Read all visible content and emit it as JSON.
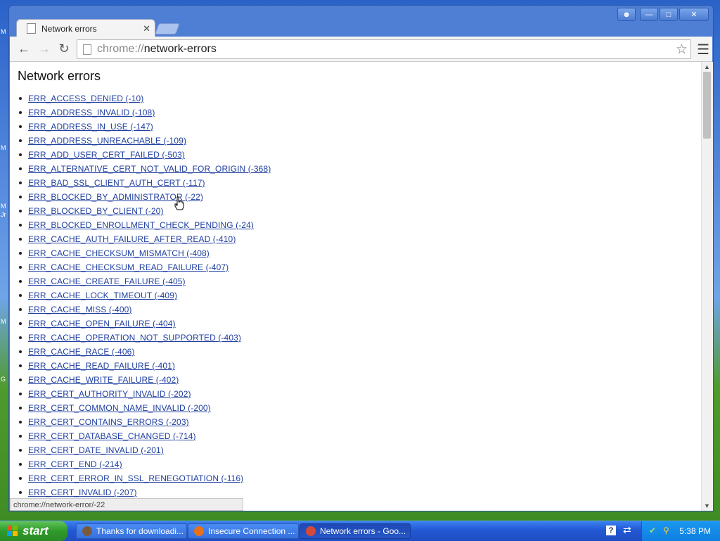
{
  "desktop": {
    "side_labels": [
      "M",
      "M",
      "M",
      "Jr",
      "M",
      "G"
    ]
  },
  "window": {
    "tab": {
      "title": "Network errors"
    },
    "toolbar": {
      "url_scheme": "chrome://",
      "url_rest": "network-errors"
    }
  },
  "page": {
    "heading": "Network errors",
    "errors": [
      "ERR_ACCESS_DENIED (-10)",
      "ERR_ADDRESS_INVALID (-108)",
      "ERR_ADDRESS_IN_USE (-147)",
      "ERR_ADDRESS_UNREACHABLE (-109)",
      "ERR_ADD_USER_CERT_FAILED (-503)",
      "ERR_ALTERNATIVE_CERT_NOT_VALID_FOR_ORIGIN (-368)",
      "ERR_BAD_SSL_CLIENT_AUTH_CERT (-117)",
      "ERR_BLOCKED_BY_ADMINISTRATOR (-22)",
      "ERR_BLOCKED_BY_CLIENT (-20)",
      "ERR_BLOCKED_ENROLLMENT_CHECK_PENDING (-24)",
      "ERR_CACHE_AUTH_FAILURE_AFTER_READ (-410)",
      "ERR_CACHE_CHECKSUM_MISMATCH (-408)",
      "ERR_CACHE_CHECKSUM_READ_FAILURE (-407)",
      "ERR_CACHE_CREATE_FAILURE (-405)",
      "ERR_CACHE_LOCK_TIMEOUT (-409)",
      "ERR_CACHE_MISS (-400)",
      "ERR_CACHE_OPEN_FAILURE (-404)",
      "ERR_CACHE_OPERATION_NOT_SUPPORTED (-403)",
      "ERR_CACHE_RACE (-406)",
      "ERR_CACHE_READ_FAILURE (-401)",
      "ERR_CACHE_WRITE_FAILURE (-402)",
      "ERR_CERT_AUTHORITY_INVALID (-202)",
      "ERR_CERT_COMMON_NAME_INVALID (-200)",
      "ERR_CERT_CONTAINS_ERRORS (-203)",
      "ERR_CERT_DATABASE_CHANGED (-714)",
      "ERR_CERT_DATE_INVALID (-201)",
      "ERR_CERT_END (-214)",
      "ERR_CERT_ERROR_IN_SSL_RENEGOTIATION (-116)",
      "ERR_CERT_INVALID (-207)"
    ]
  },
  "status_bar": {
    "text": "chrome://network-error/-22"
  },
  "taskbar": {
    "start_label": "start",
    "buttons": [
      {
        "label": "Thanks for downloadi...",
        "icon_color": "#7a5a3a",
        "active": false
      },
      {
        "label": "Insecure Connection ...",
        "icon_color": "#e8701a",
        "active": false
      },
      {
        "label": "Network errors - Goo...",
        "icon_color": "#d44a3a",
        "active": true
      }
    ],
    "clock": "5:38 PM"
  }
}
